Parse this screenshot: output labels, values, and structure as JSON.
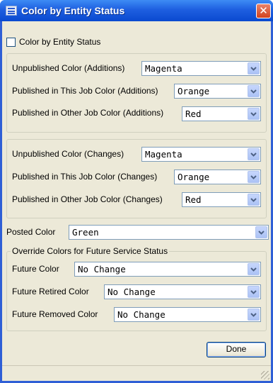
{
  "window": {
    "title": "Color by Entity Status",
    "close_glyph": "✕"
  },
  "enable_checkbox": {
    "label": "Color by Entity Status",
    "checked": false
  },
  "additions": {
    "unpublished": {
      "label": "Unpublished Color (Additions)",
      "value": "Magenta"
    },
    "published_this_job": {
      "label": "Published in This Job Color (Additions)",
      "value": "Orange"
    },
    "published_other_job": {
      "label": "Published in Other Job Color (Additions)",
      "value": "Red"
    }
  },
  "changes": {
    "unpublished": {
      "label": "Unpublished Color (Changes)",
      "value": "Magenta"
    },
    "published_this_job": {
      "label": "Published in This Job Color (Changes)",
      "value": "Orange"
    },
    "published_other_job": {
      "label": "Published in Other Job Color (Changes)",
      "value": "Red"
    }
  },
  "posted": {
    "label": "Posted Color",
    "value": "Green"
  },
  "override": {
    "legend": "Override Colors for Future Service Status",
    "future": {
      "label": "Future Color",
      "value": "No Change"
    },
    "future_retired": {
      "label": "Future Retired Color",
      "value": "No Change"
    },
    "future_removed": {
      "label": "Future Removed Color",
      "value": "No Change"
    }
  },
  "done_button": {
    "label": "Done"
  },
  "icons": {
    "window": "window-list-icon",
    "close": "close-icon",
    "dropdown": "chevron-down-icon",
    "grip": "resize-grip-icon"
  },
  "colors": {
    "titlebar": "#0a49d0",
    "face": "#ece9d8",
    "close": "#d2421e",
    "combo_border": "#7f9db9"
  }
}
